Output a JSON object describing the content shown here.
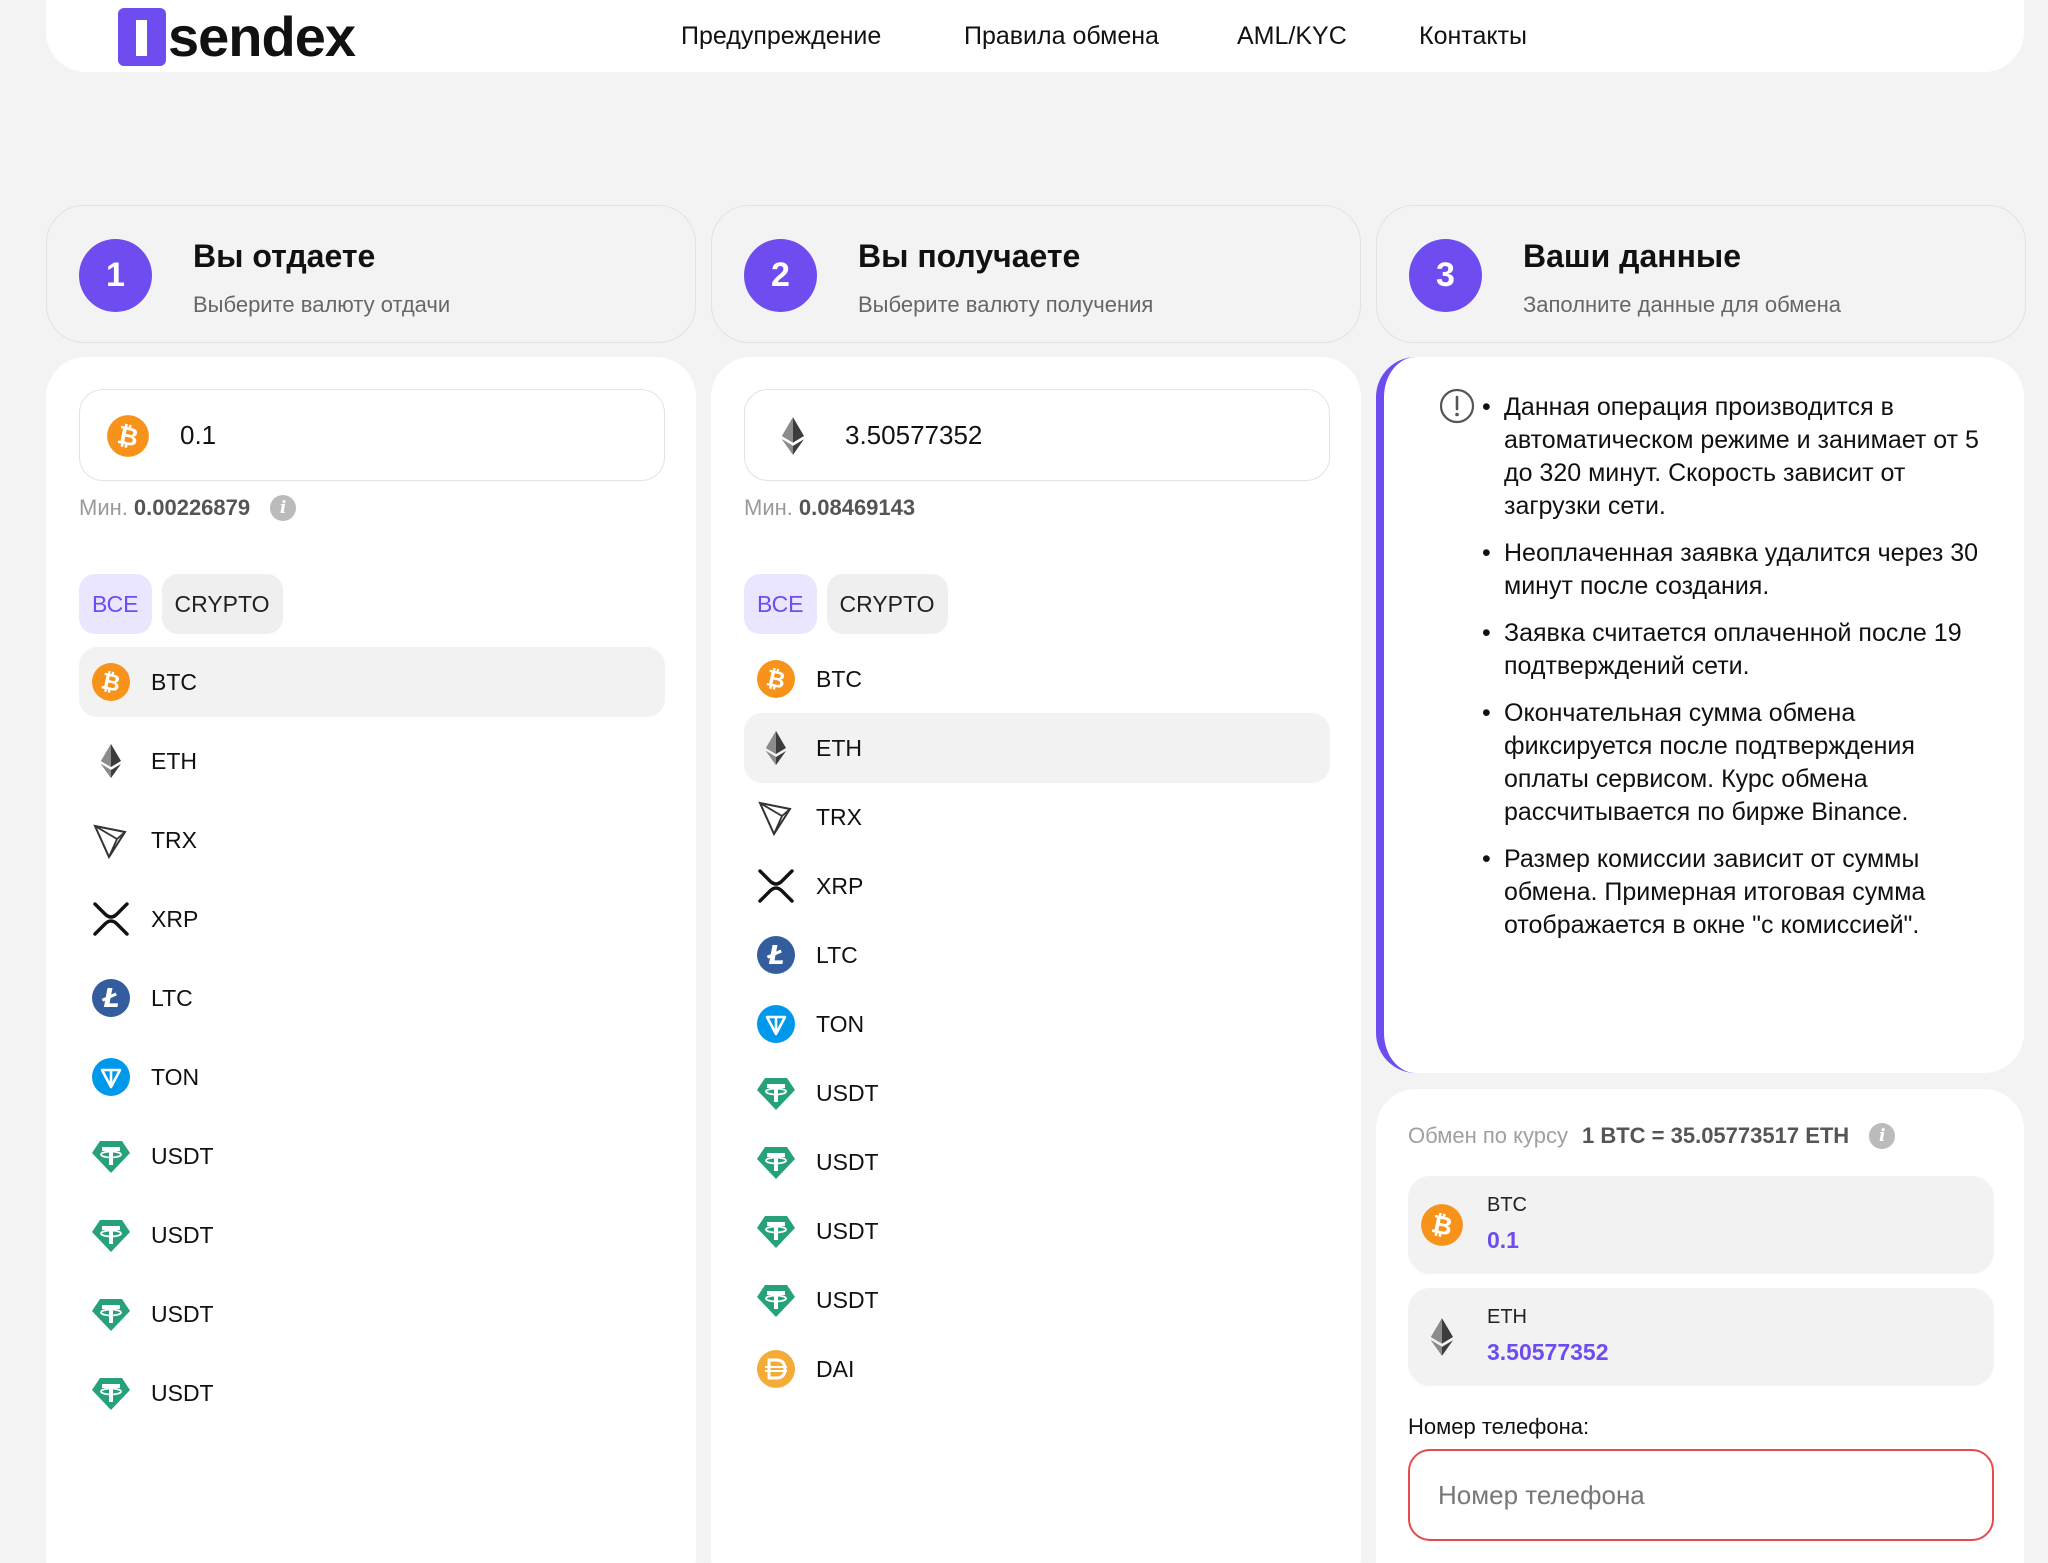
{
  "header": {
    "logo_text": "sendex",
    "nav": [
      "Предупреждение",
      "Правила обмена",
      "AML/KYC",
      "Контакты"
    ]
  },
  "steps": [
    {
      "num": "1",
      "title": "Вы отдаете",
      "subtitle": "Выберите валюту отдачи"
    },
    {
      "num": "2",
      "title": "Вы получаете",
      "subtitle": "Выберите валюту получения"
    },
    {
      "num": "3",
      "title": "Ваши данные",
      "subtitle": "Заполните данные для обмена"
    }
  ],
  "give": {
    "amount": "0.1",
    "amount_icon": "btc-icon",
    "min_label": "Мин.",
    "min_value": "0.00226879",
    "filters": [
      "ВСЕ",
      "CRYPTO"
    ],
    "coins": [
      {
        "label": "BTC",
        "icon": "btc-icon"
      },
      {
        "label": "ETH",
        "icon": "eth-icon"
      },
      {
        "label": "TRX",
        "icon": "trx-icon"
      },
      {
        "label": "XRP",
        "icon": "xrp-icon"
      },
      {
        "label": "LTC",
        "icon": "ltc-icon"
      },
      {
        "label": "TON",
        "icon": "ton-icon"
      },
      {
        "label": "USDT",
        "icon": "usdt-icon"
      },
      {
        "label": "USDT",
        "icon": "usdt-icon"
      },
      {
        "label": "USDT",
        "icon": "usdt-icon"
      },
      {
        "label": "USDT",
        "icon": "usdt-icon"
      }
    ],
    "selected": "BTC"
  },
  "receive": {
    "amount": "3.50577352",
    "amount_icon": "eth-icon",
    "min_label": "Мин.",
    "min_value": "0.08469143",
    "filters": [
      "ВСЕ",
      "CRYPTO"
    ],
    "coins": [
      {
        "label": "BTC",
        "icon": "btc-icon"
      },
      {
        "label": "ETH",
        "icon": "eth-icon"
      },
      {
        "label": "TRX",
        "icon": "trx-icon"
      },
      {
        "label": "XRP",
        "icon": "xrp-icon"
      },
      {
        "label": "LTC",
        "icon": "ltc-icon"
      },
      {
        "label": "TON",
        "icon": "ton-icon"
      },
      {
        "label": "USDT",
        "icon": "usdt-icon"
      },
      {
        "label": "USDT",
        "icon": "usdt-icon"
      },
      {
        "label": "USDT",
        "icon": "usdt-icon"
      },
      {
        "label": "USDT",
        "icon": "usdt-icon"
      },
      {
        "label": "DAI",
        "icon": "dai-icon"
      }
    ],
    "selected": "ETH"
  },
  "notice": {
    "items": [
      "Данная операция производится в автоматическом режиме и занимает от 5 до 320 минут. Скорость зависит от загрузки сети.",
      "Неоплаченная заявка удалится через 30 минут после создания.",
      "Заявка считается оплаченной после 19 подтверждений сети.",
      "Окончательная сумма обмена фиксируется после подтверждения оплаты сервисом. Курс обмена рассчитывается по бирже Binance.",
      "Размер комиссии зависит от суммы обмена. Примерная итоговая сумма отображается в окне \"с комиссией\"."
    ]
  },
  "summary": {
    "rate_label": "Обмен по курсу",
    "rate_value": "1 BTC = 35.05773517 ETH",
    "give": {
      "name": "BTC",
      "amount": "0.1"
    },
    "receive": {
      "name": "ETH",
      "amount": "3.50577352"
    },
    "phone_label": "Номер телефона:",
    "phone_placeholder": "Номер телефона",
    "phone_value": ""
  },
  "colors": {
    "accent": "#6f4cf0",
    "btc": "#f7931a",
    "ltc": "#345d9d",
    "ton": "#0098ea",
    "usdt": "#26a17b",
    "dai": "#f5ac37",
    "error": "#e54b4b"
  }
}
